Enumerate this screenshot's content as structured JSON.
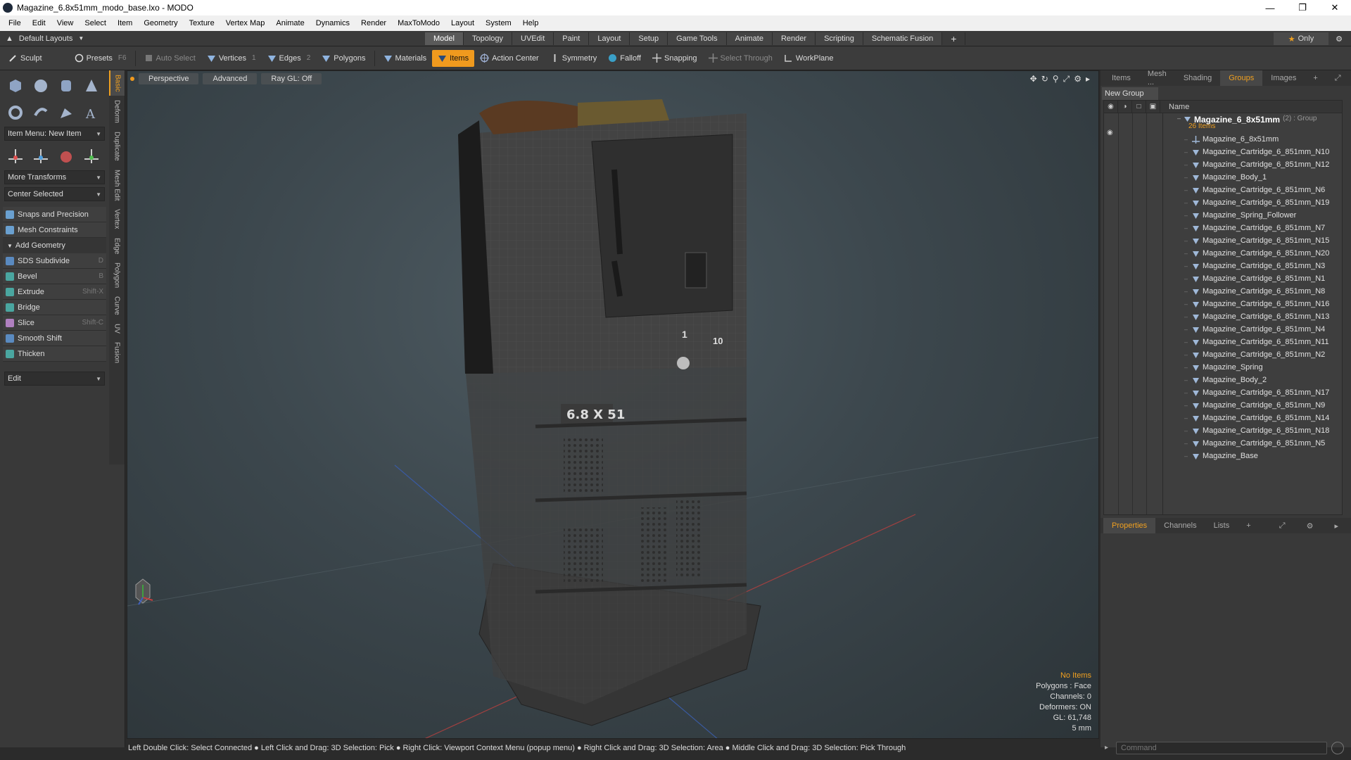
{
  "window": {
    "title": "Magazine_6.8x51mm_modo_base.lxo - MODO",
    "minimize": "—",
    "maximize": "❐",
    "close": "✕"
  },
  "menu": [
    "File",
    "Edit",
    "View",
    "Select",
    "Item",
    "Geometry",
    "Texture",
    "Vertex Map",
    "Animate",
    "Dynamics",
    "Render",
    "MaxToModo",
    "Layout",
    "System",
    "Help"
  ],
  "layout_bar": {
    "layouts_label": "Default Layouts",
    "tabs": [
      "Model",
      "Topology",
      "UVEdit",
      "Paint",
      "Layout",
      "Setup",
      "Game Tools",
      "Animate",
      "Render",
      "Scripting",
      "Schematic Fusion"
    ],
    "active_tab": "Model",
    "plus": "+",
    "only_label": "Only"
  },
  "toolbar": {
    "sculpt": "Sculpt",
    "presets": "Presets",
    "presets_key": "F6",
    "auto_select": "Auto Select",
    "vertices": "Vertices",
    "vertices_num": "1",
    "edges": "Edges",
    "edges_num": "2",
    "polygons": "Polygons",
    "materials": "Materials",
    "items": "Items",
    "action_center": "Action Center",
    "symmetry": "Symmetry",
    "falloff": "Falloff",
    "snapping": "Snapping",
    "select_through": "Select Through",
    "workplane": "WorkPlane"
  },
  "left_panel": {
    "item_menu": "Item Menu: New Item",
    "more_transforms": "More Transforms",
    "center_selected": "Center Selected",
    "snaps": "Snaps and Precision",
    "mesh_constraints": "Mesh Constraints",
    "add_geometry": "Add Geometry",
    "tools": [
      {
        "label": "SDS Subdivide",
        "key": "D",
        "color": "#5a8ac0"
      },
      {
        "label": "Bevel",
        "key": "B",
        "color": "#4aa6a0"
      },
      {
        "label": "Extrude",
        "key": "Shift-X",
        "color": "#4aa6a0"
      },
      {
        "label": "Bridge",
        "key": "",
        "color": "#4aa6a0"
      },
      {
        "label": "Slice",
        "key": "Shift-C",
        "color": "#b080c0"
      },
      {
        "label": "Smooth Shift",
        "key": "",
        "color": "#5a8ac0"
      },
      {
        "label": "Thicken",
        "key": "",
        "color": "#4aa6a0"
      }
    ],
    "edit": "Edit",
    "vtabs": [
      "Basic",
      "Deform",
      "Duplicate",
      "Mesh Edit",
      "Vertex",
      "Edge",
      "Polygon",
      "Curve",
      "UV",
      "Fusion"
    ]
  },
  "viewport": {
    "tabs": [
      "Perspective",
      "Advanced",
      "Ray GL: Off"
    ],
    "model_label": "6.8 X 51",
    "mark_1": "1",
    "mark_10": "10",
    "info": {
      "no_items": "No Items",
      "polygons": "Polygons : Face",
      "channels": "Channels: 0",
      "deformers": "Deformers: ON",
      "gl": "GL: 61,748",
      "scale": "5 mm"
    }
  },
  "status_bar": "Left Double Click: Select Connected ● Left Click and Drag: 3D Selection: Pick ● Right Click: Viewport Context Menu (popup menu) ● Right Click and Drag: 3D Selection: Area ● Middle Click and Drag: 3D Selection: Pick Through",
  "right_panel": {
    "tabs": [
      "Items",
      "Mesh ...",
      "Shading",
      "Groups",
      "Images"
    ],
    "active_tab": "Groups",
    "plus": "+",
    "new_group": "New Group",
    "name_header": "Name",
    "group": {
      "name": "Magazine_6_8x51mm",
      "count": "(2) : Group",
      "sub": "26 Items"
    },
    "items": [
      "Magazine_6_8x51mm",
      "Magazine_Cartridge_6_851mm_N10",
      "Magazine_Cartridge_6_851mm_N12",
      "Magazine_Body_1",
      "Magazine_Cartridge_6_851mm_N6",
      "Magazine_Cartridge_6_851mm_N19",
      "Magazine_Spring_Follower",
      "Magazine_Cartridge_6_851mm_N7",
      "Magazine_Cartridge_6_851mm_N15",
      "Magazine_Cartridge_6_851mm_N20",
      "Magazine_Cartridge_6_851mm_N3",
      "Magazine_Cartridge_6_851mm_N1",
      "Magazine_Cartridge_6_851mm_N8",
      "Magazine_Cartridge_6_851mm_N16",
      "Magazine_Cartridge_6_851mm_N13",
      "Magazine_Cartridge_6_851mm_N4",
      "Magazine_Cartridge_6_851mm_N11",
      "Magazine_Cartridge_6_851mm_N2",
      "Magazine_Spring",
      "Magazine_Body_2",
      "Magazine_Cartridge_6_851mm_N17",
      "Magazine_Cartridge_6_851mm_N9",
      "Magazine_Cartridge_6_851mm_N14",
      "Magazine_Cartridge_6_851mm_N18",
      "Magazine_Cartridge_6_851mm_N5",
      "Magazine_Base"
    ],
    "props_tabs": [
      "Properties",
      "Channels",
      "Lists"
    ],
    "props_active": "Properties",
    "command_placeholder": "Command"
  },
  "colors": {
    "accent": "#f09a1e",
    "viewport_bg": "#3c474d"
  }
}
